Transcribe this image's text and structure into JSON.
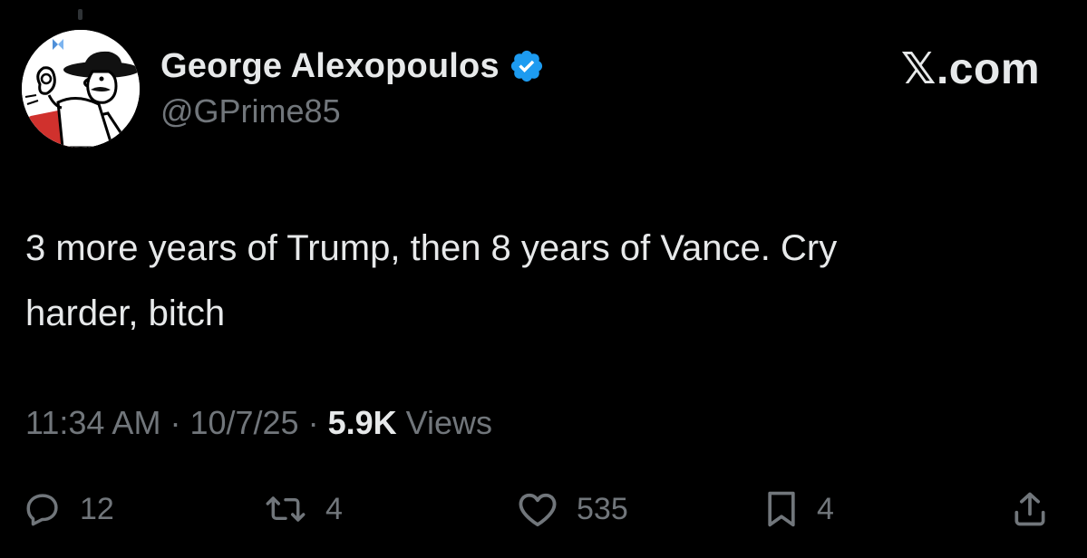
{
  "author": {
    "display_name": "George Alexopoulos",
    "handle": "@GPrime85",
    "verified": true,
    "verified_color": "#1d9bf0"
  },
  "brand": "𝕏.com",
  "tweet": {
    "text_line1": "3 more years of Trump, then 8 years of Vance. Cry",
    "text_line2": "harder, bitch"
  },
  "meta": {
    "time": "11:34 AM",
    "separator": "·",
    "date": "10/7/25",
    "views_count": "5.9K",
    "views_label": "Views"
  },
  "actions": {
    "replies": "12",
    "reposts": "4",
    "likes": "535",
    "bookmarks": "4",
    "reply_icon": "speech-bubble-icon",
    "repost_icon": "repost-arrows-icon",
    "like_icon": "heart-icon",
    "bookmark_icon": "bookmark-icon",
    "share_icon": "share-upload-icon"
  },
  "colors": {
    "background": "#000000",
    "text_primary": "#e7e9ea",
    "text_secondary": "#71767b"
  }
}
